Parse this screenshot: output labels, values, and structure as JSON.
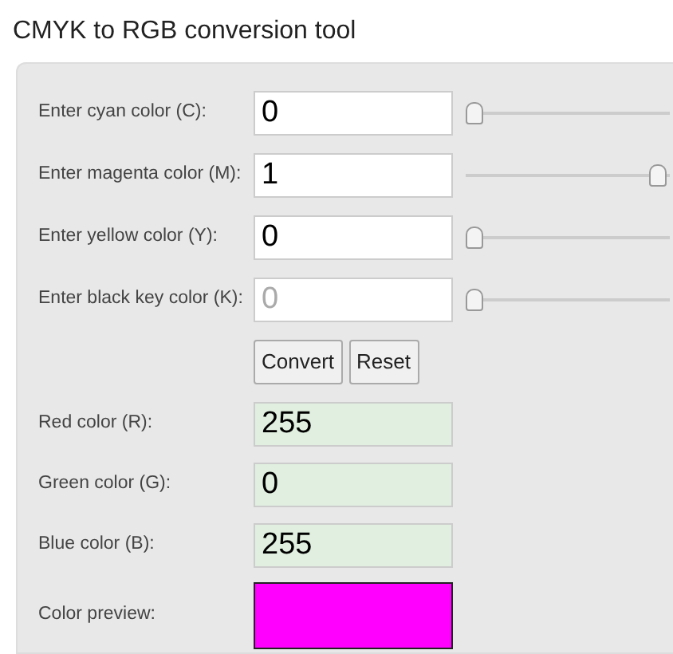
{
  "title": "CMYK to RGB conversion tool",
  "inputs": [
    {
      "label": "Enter cyan color (C):",
      "value": "0",
      "level": 0
    },
    {
      "label": "Enter magenta color (M):",
      "value": "1",
      "level": 1
    },
    {
      "label": "Enter yellow color (Y):",
      "value": "0",
      "level": 0
    },
    {
      "label": "Enter black key color (K):",
      "placeholder": "0",
      "level": 0
    }
  ],
  "buttons": [
    "Convert",
    "Reset"
  ],
  "outputs": [
    {
      "label": "Red color (R):",
      "value": "255"
    },
    {
      "label": "Green color (G):",
      "value": "0"
    },
    {
      "label": "Blue color (B):",
      "value": "255"
    }
  ],
  "preview": {
    "label": "Color preview:",
    "color": "#ff00ff"
  }
}
